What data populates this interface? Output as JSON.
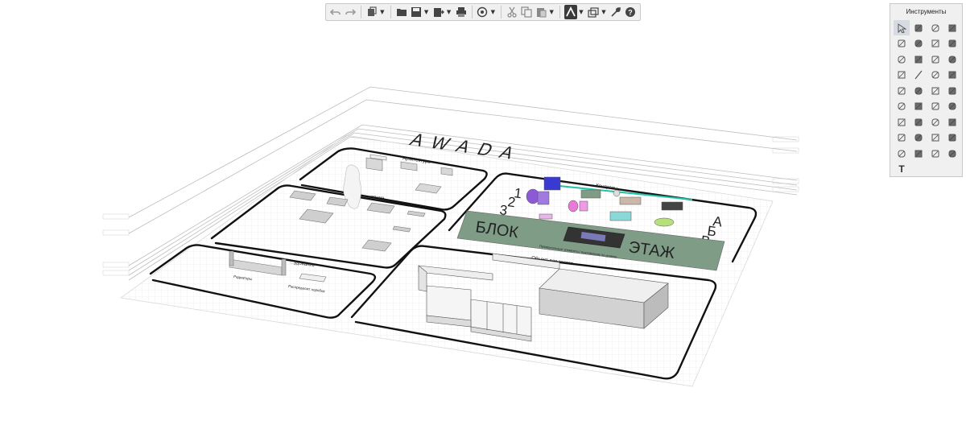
{
  "toolbar": {
    "buttons": [
      {
        "name": "undo-button",
        "icon": "undo-icon"
      },
      {
        "name": "redo-button",
        "icon": "redo-icon"
      },
      {
        "name": "views-button",
        "icon": "views-icon",
        "dropdown": true
      },
      {
        "name": "open-button",
        "icon": "folder-icon"
      },
      {
        "name": "save-button",
        "icon": "save-icon",
        "dropdown": true
      },
      {
        "name": "export-button",
        "icon": "export-icon",
        "dropdown": true
      },
      {
        "name": "print-button",
        "icon": "print-icon"
      },
      {
        "name": "orbit-button",
        "icon": "orbit-icon",
        "dropdown": true
      },
      {
        "name": "cut-button",
        "icon": "scissors-icon"
      },
      {
        "name": "copy-button",
        "icon": "copy-icon"
      },
      {
        "name": "paste-button",
        "icon": "paste-icon",
        "dropdown": true
      },
      {
        "name": "logo-button",
        "icon": "app-logo-icon",
        "dropdown": true
      },
      {
        "name": "layers-button",
        "icon": "layers-icon",
        "dropdown": true
      },
      {
        "name": "settings-button",
        "icon": "wrench-icon"
      },
      {
        "name": "help-button",
        "icon": "help-icon"
      }
    ]
  },
  "palette": {
    "title": "Инструменты",
    "tools": [
      "select-arrow-icon",
      "orbit-paint-icon",
      "box-icon",
      "column-icon",
      "wall-icon",
      "slab-icon",
      "roof-icon",
      "pencil-icon",
      "eraser-icon",
      "hatch-icon",
      "door-icon",
      "window-icon",
      "railing-icon",
      "line-icon",
      "figure-icon",
      "tape-icon",
      "stair-icon",
      "panel-icon",
      "component-icon",
      "pipe-icon",
      "section-icon",
      "grid-icon",
      "rotate-icon",
      "move-icon",
      "duplicate-icon",
      "shape-icon",
      "scale-icon",
      "copy-shape-icon",
      "calculator-icon",
      "gear-shape-icon",
      "camera-icon",
      "mirror-icon",
      "image-icon",
      "dimension-icon",
      "arc-icon",
      "group-icon"
    ],
    "text_tool": "T"
  },
  "scene": {
    "logo_text": "AWADA",
    "zones": {
      "architecture": "Архитектура",
      "furnishing": "...жение",
      "equipment": "...удование",
      "controls": "Контролы",
      "test_object": "Объект для тестов"
    },
    "block_label": "БЛОК",
    "floor_label": "ЭТАЖ",
    "numbers": [
      "1",
      "2",
      "3"
    ],
    "letters": [
      "А",
      "Б",
      "В"
    ],
    "equipment_items": [
      "Радиаторы",
      "Распределит. коробка"
    ],
    "note_text": "Прямоугольные элементы / выставление по уровню"
  },
  "colors": {
    "panel_bg": "#f0f0f0",
    "band_green": "#7f9c87",
    "accent_teal": "#1fc3a8",
    "purple": "#8c5ad6",
    "blue": "#3a3ad0",
    "pink": "#e87ad8",
    "cyan": "#8ad8d8",
    "lime": "#b6e07a"
  }
}
